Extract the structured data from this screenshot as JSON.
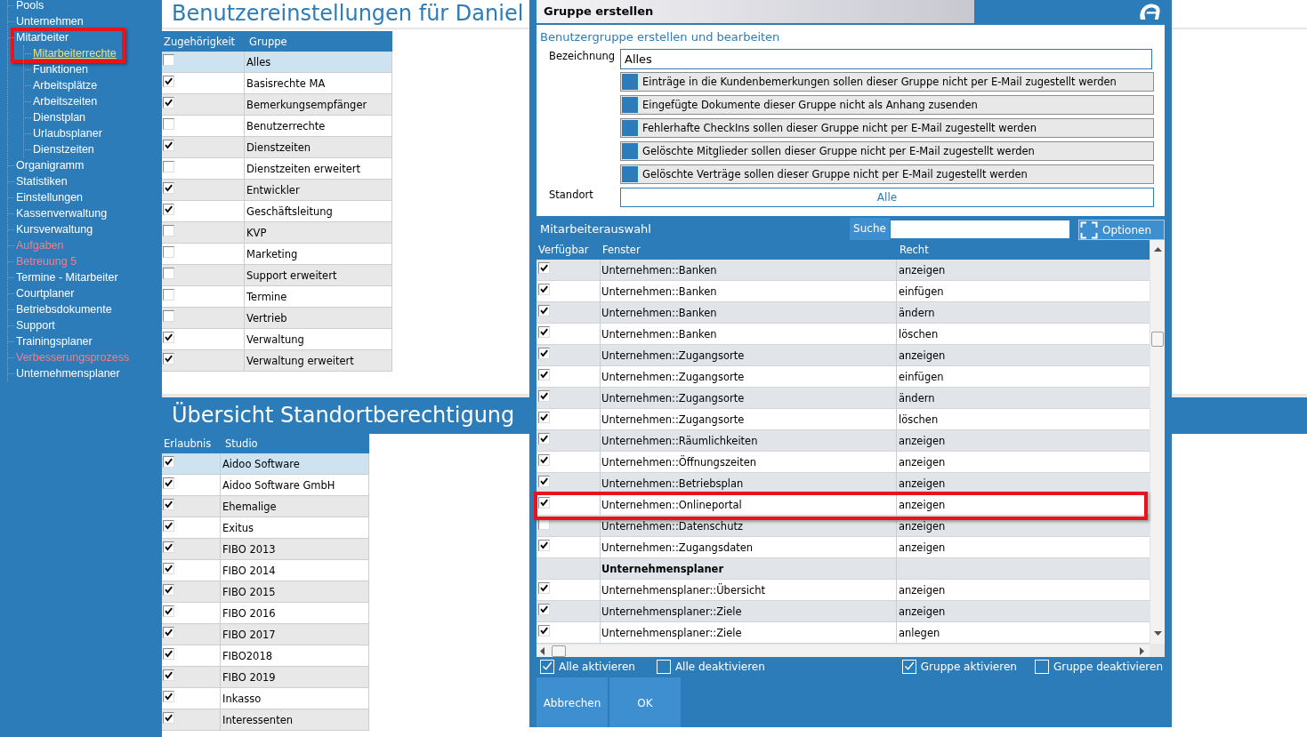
{
  "sidebar": {
    "items": [
      {
        "label": "Pools",
        "color": "#ffffff",
        "selected": false,
        "highlighted": false
      },
      {
        "label": "Unternehmen",
        "color": "#ffffff",
        "selected": false,
        "highlighted": false
      },
      {
        "label": "Mitarbeiter",
        "color": "#ffffff",
        "selected": false,
        "highlighted": true,
        "children": [
          {
            "label": "Mitarbeiterrechte",
            "selected": true
          },
          {
            "label": "Funktionen",
            "selected": false
          },
          {
            "label": "Arbeitsplätze",
            "selected": false
          },
          {
            "label": "Arbeitszeiten",
            "selected": false
          },
          {
            "label": "Dienstplan",
            "selected": false
          },
          {
            "label": "Urlaubsplaner",
            "selected": false
          },
          {
            "label": "Dienstzeiten",
            "selected": false
          }
        ]
      },
      {
        "label": "Organigramm",
        "color": "#ffffff",
        "selected": false,
        "highlighted": false
      },
      {
        "label": "Statistiken",
        "color": "#ffffff",
        "selected": false,
        "highlighted": false
      },
      {
        "label": "Einstellungen",
        "color": "#ffffff",
        "selected": false,
        "highlighted": false
      },
      {
        "label": "Kassenverwaltung",
        "color": "#ffffff",
        "selected": false,
        "highlighted": false
      },
      {
        "label": "Kursverwaltung",
        "color": "#ffffff",
        "selected": false,
        "highlighted": false
      },
      {
        "label": "Aufgaben",
        "color": "#f0808c",
        "selected": false,
        "highlighted": false
      },
      {
        "label": "Betreuung 5",
        "color": "#f0808c",
        "selected": false,
        "highlighted": false
      },
      {
        "label": "Termine - Mitarbeiter",
        "color": "#ffffff",
        "selected": false,
        "highlighted": false
      },
      {
        "label": "Courtplaner",
        "color": "#ffffff",
        "selected": false,
        "highlighted": false
      },
      {
        "label": "Betriebsdokumente",
        "color": "#ffffff",
        "selected": false,
        "highlighted": false
      },
      {
        "label": "Support",
        "color": "#ffffff",
        "selected": false,
        "highlighted": false
      },
      {
        "label": "Trainingsplaner",
        "color": "#ffffff",
        "selected": false,
        "highlighted": false
      },
      {
        "label": "Verbesserungsprozess",
        "color": "#f0808c",
        "selected": false,
        "highlighted": false
      },
      {
        "label": "Unternehmensplaner",
        "color": "#ffffff",
        "selected": false,
        "highlighted": false
      }
    ]
  },
  "user_settings": {
    "title": "Benutzereinstellungen für Daniel",
    "groups_table": {
      "columns": [
        "Zugehörigkeit",
        "Gruppe"
      ],
      "rows": [
        {
          "checked": false,
          "group": "Alles",
          "selected": true
        },
        {
          "checked": true,
          "group": "Basisrechte MA",
          "selected": false
        },
        {
          "checked": true,
          "group": "Bemerkungsempfänger",
          "selected": false
        },
        {
          "checked": false,
          "group": "Benutzerrechte",
          "selected": false
        },
        {
          "checked": true,
          "group": "Dienstzeiten",
          "selected": false
        },
        {
          "checked": false,
          "group": "Dienstzeiten erweitert",
          "selected": false
        },
        {
          "checked": true,
          "group": "Entwickler",
          "selected": false
        },
        {
          "checked": true,
          "group": "Geschäftsleitung",
          "selected": false
        },
        {
          "checked": false,
          "group": "KVP",
          "selected": false
        },
        {
          "checked": false,
          "group": "Marketing",
          "selected": false
        },
        {
          "checked": false,
          "group": "Support erweitert",
          "selected": false
        },
        {
          "checked": false,
          "group": "Termine",
          "selected": false
        },
        {
          "checked": false,
          "group": "Vertrieb",
          "selected": false
        },
        {
          "checked": true,
          "group": "Verwaltung",
          "selected": false
        },
        {
          "checked": true,
          "group": "Verwaltung erweitert",
          "selected": false
        }
      ]
    }
  },
  "location_permissions": {
    "title": "Übersicht Standortberechtigung",
    "table": {
      "columns": [
        "Erlaubnis",
        "Studio"
      ],
      "rows": [
        {
          "checked": true,
          "studio": "Aidoo Software",
          "selected": true
        },
        {
          "checked": true,
          "studio": "Aidoo Software GmbH",
          "selected": false
        },
        {
          "checked": true,
          "studio": "Ehemalige",
          "selected": false
        },
        {
          "checked": true,
          "studio": "Exitus",
          "selected": false
        },
        {
          "checked": true,
          "studio": "FIBO 2013",
          "selected": false
        },
        {
          "checked": true,
          "studio": "FIBO 2014",
          "selected": false
        },
        {
          "checked": true,
          "studio": "FIBO 2015",
          "selected": false
        },
        {
          "checked": true,
          "studio": "FIBO 2016",
          "selected": false
        },
        {
          "checked": true,
          "studio": "FIBO 2017",
          "selected": false
        },
        {
          "checked": true,
          "studio": "FIBO2018",
          "selected": false
        },
        {
          "checked": true,
          "studio": "FIBO 2019",
          "selected": false
        },
        {
          "checked": true,
          "studio": "Inkasso",
          "selected": false
        },
        {
          "checked": true,
          "studio": "Interessenten",
          "selected": false
        }
      ]
    }
  },
  "dialog": {
    "title": "Gruppe erstellen",
    "subtitle": "Benutzergruppe erstellen und bearbeiten",
    "name_field": {
      "label": "Bezeichnung",
      "value": "Alles"
    },
    "options": [
      {
        "label": "Einträge in die Kundenbemerkungen sollen dieser Gruppe nicht per E-Mail zugestellt werden",
        "checked": false
      },
      {
        "label": "Eingefügte Dokumente dieser Gruppe nicht als Anhang zusenden",
        "checked": false
      },
      {
        "label": "Fehlerhafte CheckIns sollen dieser Gruppe nicht per E-Mail zugestellt werden",
        "checked": false
      },
      {
        "label": "Gelöschte Mitglieder sollen dieser Gruppe nicht per E-Mail zugestellt werden",
        "checked": false
      },
      {
        "label": "Gelöschte Verträge sollen dieser Gruppe nicht per E-Mail zugestellt werden",
        "checked": false
      }
    ],
    "location_field": {
      "label": "Standort",
      "value": "Alle"
    },
    "employee_selection": {
      "title": "Mitarbeiterauswahl",
      "search": {
        "label": "Suche"
      },
      "options_button": "Optionen",
      "table": {
        "columns": [
          "Verfügbar",
          "Fenster",
          "Recht"
        ],
        "rows": [
          {
            "kind": "entry",
            "checked": true,
            "window": "Unternehmen::Banken",
            "right": "anzeigen",
            "highlighted": false
          },
          {
            "kind": "entry",
            "checked": true,
            "window": "Unternehmen::Banken",
            "right": "einfügen",
            "highlighted": false
          },
          {
            "kind": "entry",
            "checked": true,
            "window": "Unternehmen::Banken",
            "right": "ändern",
            "highlighted": false
          },
          {
            "kind": "entry",
            "checked": true,
            "window": "Unternehmen::Banken",
            "right": "löschen",
            "highlighted": false
          },
          {
            "kind": "entry",
            "checked": true,
            "window": "Unternehmen::Zugangsorte",
            "right": "anzeigen",
            "highlighted": false
          },
          {
            "kind": "entry",
            "checked": true,
            "window": "Unternehmen::Zugangsorte",
            "right": "einfügen",
            "highlighted": false
          },
          {
            "kind": "entry",
            "checked": true,
            "window": "Unternehmen::Zugangsorte",
            "right": "ändern",
            "highlighted": false
          },
          {
            "kind": "entry",
            "checked": true,
            "window": "Unternehmen::Zugangsorte",
            "right": "löschen",
            "highlighted": false
          },
          {
            "kind": "entry",
            "checked": true,
            "window": "Unternehmen::Räumlichkeiten",
            "right": "anzeigen",
            "highlighted": false
          },
          {
            "kind": "entry",
            "checked": true,
            "window": "Unternehmen::Öffnungszeiten",
            "right": "anzeigen",
            "highlighted": false
          },
          {
            "kind": "entry",
            "checked": true,
            "window": "Unternehmen::Betriebsplan",
            "right": "anzeigen",
            "highlighted": false
          },
          {
            "kind": "entry",
            "checked": true,
            "window": "Unternehmen::Onlineportal",
            "right": "anzeigen",
            "highlighted": true
          },
          {
            "kind": "entry",
            "checked": false,
            "window": "Unternehmen::Datenschutz",
            "right": "anzeigen",
            "highlighted": false
          },
          {
            "kind": "entry",
            "checked": true,
            "window": "Unternehmen::Zugangsdaten",
            "right": "anzeigen",
            "highlighted": false
          },
          {
            "kind": "group",
            "label": "Unternehmensplaner",
            "highlighted": false
          },
          {
            "kind": "entry",
            "checked": true,
            "window": "Unternehmensplaner::Übersicht",
            "right": "anzeigen",
            "highlighted": false
          },
          {
            "kind": "entry",
            "checked": true,
            "window": "Unternehmensplaner::Ziele",
            "right": "anzeigen",
            "highlighted": false
          },
          {
            "kind": "entry",
            "checked": true,
            "window": "Unternehmensplaner::Ziele",
            "right": "anlegen",
            "highlighted": false
          }
        ]
      }
    },
    "bulk_toggles": [
      {
        "label": "Alle aktivieren",
        "checked": true
      },
      {
        "label": "Alle deaktivieren",
        "checked": false
      },
      {
        "label": "Gruppe aktivieren",
        "checked": true
      },
      {
        "label": "Gruppe deaktivieren",
        "checked": false
      }
    ],
    "buttons": [
      "Abbrechen",
      "OK"
    ]
  }
}
